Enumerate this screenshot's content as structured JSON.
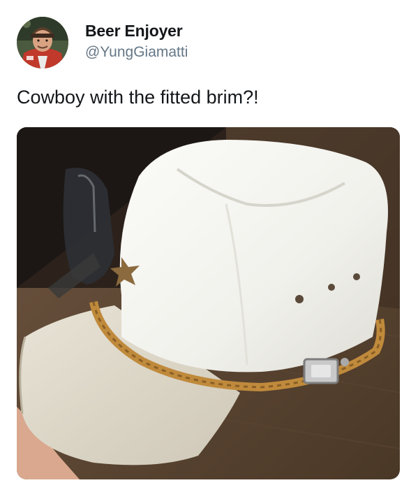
{
  "tweet": {
    "author": {
      "display_name": "Beer Enjoyer",
      "handle": "@YungGiamatti",
      "avatar_icon": "avatar-photo-icon"
    },
    "text": "Cowboy with the fitted brim?!",
    "media": {
      "icon": "photo-white-cowboy-hat-with-flat-cap-brim"
    }
  },
  "colors": {
    "text": "#14171a",
    "secondary_text": "#657786",
    "background": "#ffffff"
  }
}
